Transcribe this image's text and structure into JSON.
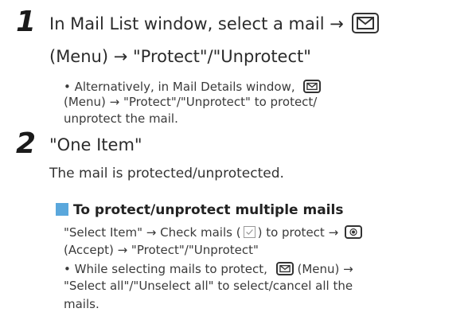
{
  "step1": {
    "number": "1",
    "line1_before": "In Mail List window, select a mail →",
    "line2": "(Menu) → \"Protect\"/\"Unprotect\"",
    "note_part1": "• Alternatively, in Mail Details window,",
    "note_line2": "(Menu)    → \"Protect\"/\"Unprotect\" to protect/",
    "note_line3": "unprotect the mail."
  },
  "step2": {
    "number": "2",
    "title": "\"One Item\"",
    "result": "The mail is protected/unprotected."
  },
  "section": {
    "title": "To protect/unprotect multiple mails",
    "line1_before": "\"Select Item\" → Check mails (",
    "line1_after": ") to protect →",
    "line2": "(Accept) → \"Protect\"/\"Unprotect\"",
    "bullet_line1": "• While selecting mails to protect,",
    "bullet_line1_end": "(Menu)     →",
    "bullet_line2": "\"Select all\"/\"Unselect all\" to select/cancel all the",
    "bullet_line3": "mails."
  }
}
